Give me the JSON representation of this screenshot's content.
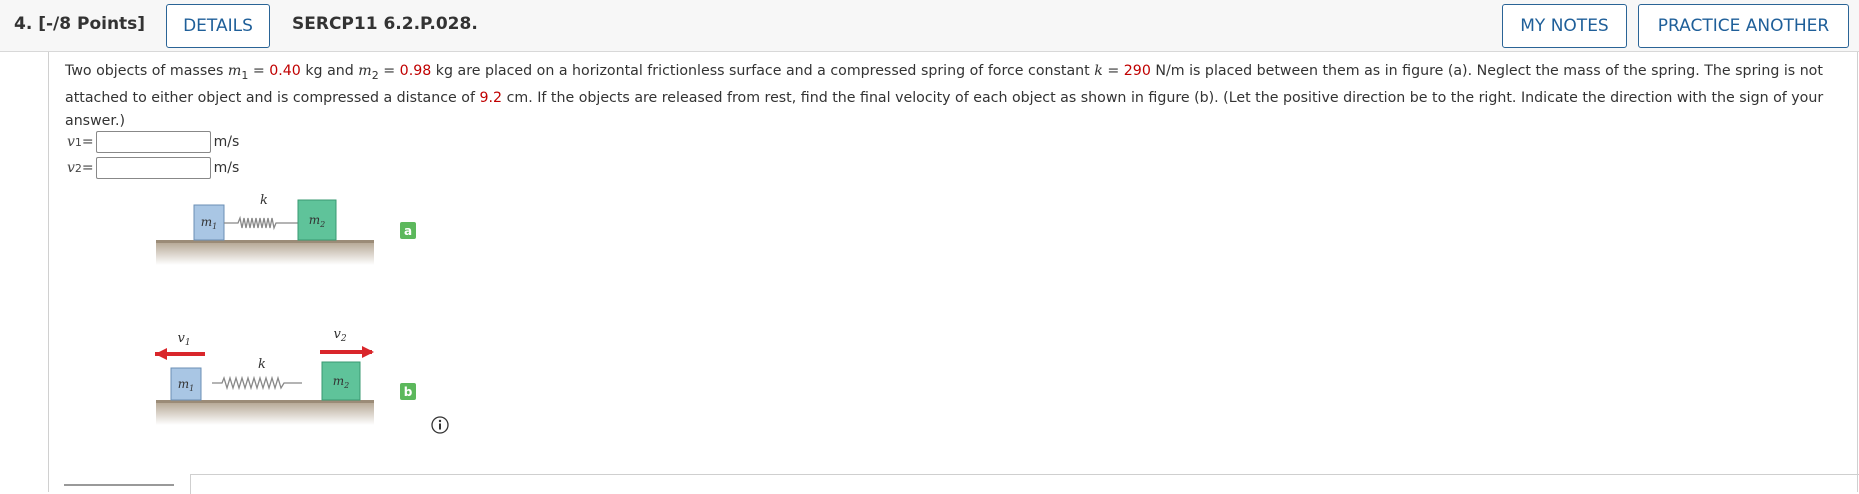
{
  "header": {
    "question_label": "4. [-/8 Points]",
    "details_button": "DETAILS",
    "problem_code": "SERCP11 6.2.P.028.",
    "my_notes_button": "MY NOTES",
    "practice_button": "PRACTICE ANOTHER"
  },
  "problem": {
    "t1": "Two objects of masses ",
    "m1_sym": "m",
    "m1_sub": "1",
    "eq1": " = ",
    "m1_val": "0.40",
    "t2": " kg and ",
    "m2_sym": "m",
    "m2_sub": "2",
    "eq2": " = ",
    "m2_val": "0.98",
    "t3": " kg are placed on a horizontal frictionless surface and a compressed spring of force constant ",
    "k_sym": "k",
    "eq3": " = ",
    "k_val": "290",
    "t4": " N/m is placed between them as in figure (a). Neglect the mass of the spring. The spring is not attached to either object and is compressed a distance of ",
    "d_val": "9.2",
    "t5": " cm. If the objects are released from rest, find the final velocity of each object as shown in figure (b). (Let the positive direction be to the right. Indicate the direction with the sign of your answer.)"
  },
  "answers": [
    {
      "sym": "v",
      "sub": "1",
      "eq": " =",
      "value": "",
      "unit": "m/s"
    },
    {
      "sym": "v",
      "sub": "2",
      "eq": " =",
      "value": "",
      "unit": "m/s"
    }
  ],
  "figure": {
    "m1_label": "m",
    "m1_sub": "1",
    "m2_label": "m",
    "m2_sub": "2",
    "k_label": "k",
    "v1_label": "v",
    "v1_sub": "1",
    "v2_label": "v",
    "v2_sub": "2",
    "tag_a": "a",
    "tag_b": "b",
    "tag_color": "#5cb85c",
    "m1_color": "#a9c6e4",
    "m2_color": "#5fc39a",
    "arrow_color": "#d9262b"
  }
}
